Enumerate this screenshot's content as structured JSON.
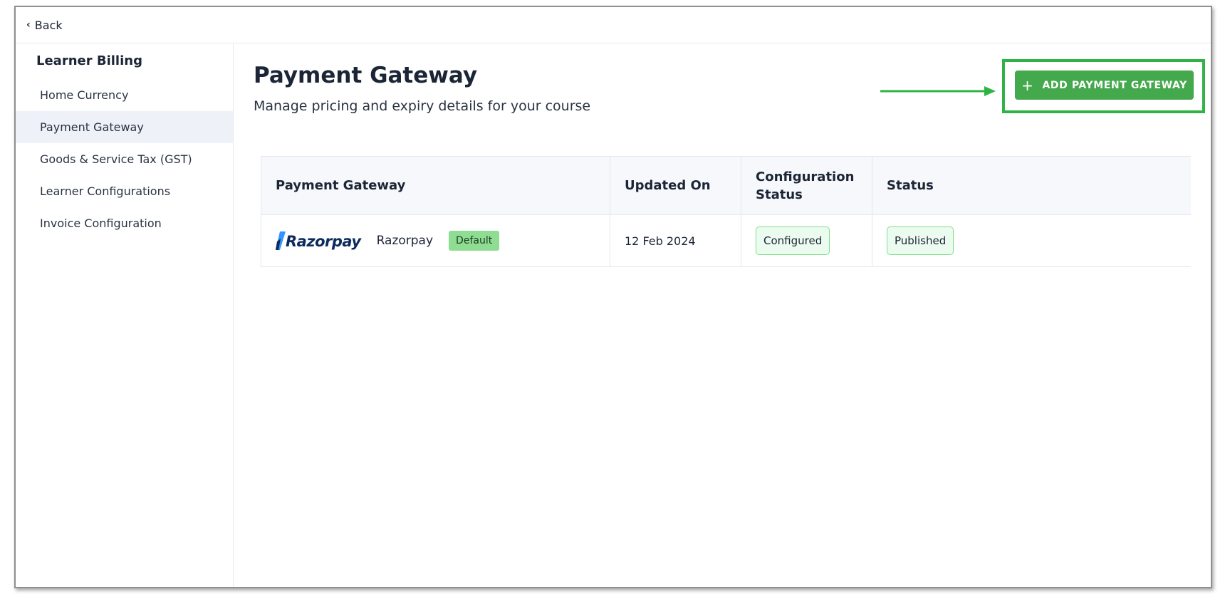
{
  "nav": {
    "back_label": "Back"
  },
  "sidebar": {
    "title": "Learner Billing",
    "items": [
      {
        "label": "Home Currency"
      },
      {
        "label": "Payment Gateway",
        "active": true
      },
      {
        "label": "Goods & Service Tax (GST)"
      },
      {
        "label": "Learner Configurations"
      },
      {
        "label": "Invoice Configuration"
      }
    ]
  },
  "main": {
    "title": "Payment Gateway",
    "subtitle": "Manage pricing and expiry details for your course",
    "add_button_label": "ADD PAYMENT GATEWAY",
    "add_button_icon": "plus-icon",
    "table": {
      "headers": [
        "Payment Gateway",
        "Updated On",
        "Configuration Status",
        "Status"
      ],
      "rows": [
        {
          "logo_text": "Razorpay",
          "name": "Razorpay",
          "badge": "Default",
          "updated_on": "12 Feb 2024",
          "configuration_status": "Configured",
          "status": "Published"
        }
      ]
    }
  },
  "colors": {
    "accent_green": "#43a94c",
    "highlight_green": "#2fb344",
    "badge_green": "#8fdc93",
    "razorpay_navy": "#0d2a5c",
    "razorpay_blue": "#3395ff"
  }
}
